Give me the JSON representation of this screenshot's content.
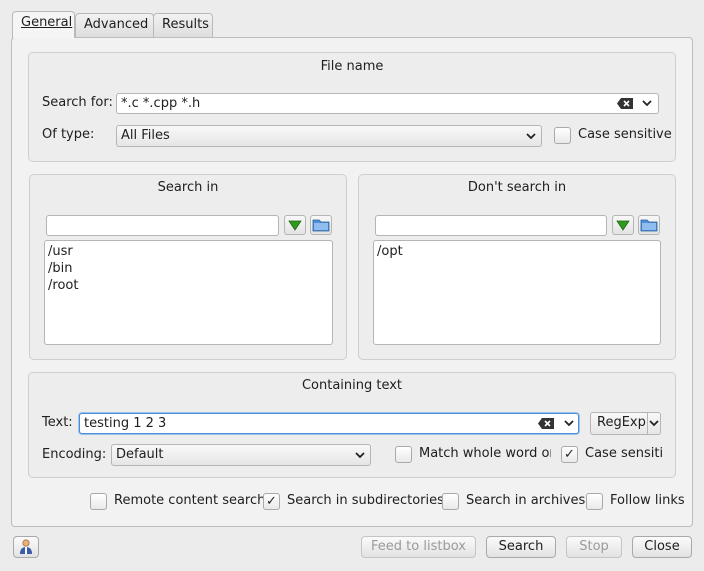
{
  "tabs": [
    {
      "label": "General"
    },
    {
      "label": "Advanced"
    },
    {
      "label": "Results"
    }
  ],
  "file_name": {
    "title": "File name",
    "search_for_label": "Search for:",
    "search_for_value": "*.c *.cpp *.h",
    "of_type_label": "Of type:",
    "of_type_value": "All Files",
    "case_sensitive_label": "Case sensitive",
    "case_sensitive_checked": false
  },
  "search_in": {
    "title": "Search in",
    "path_value": "",
    "items": [
      "/usr",
      "/bin",
      "/root"
    ]
  },
  "dont_search_in": {
    "title": "Don't search in",
    "path_value": "",
    "items": [
      "/opt"
    ]
  },
  "containing_text": {
    "title": "Containing text",
    "text_label": "Text:",
    "text_value": "testing 1 2 3",
    "regexp_label": "RegExp",
    "encoding_label": "Encoding:",
    "encoding_value": "Default",
    "match_whole_word_label": "Match whole word onl",
    "match_whole_word_checked": false,
    "case_sensitive_label": "Case sensitiv",
    "case_sensitive_checked": true
  },
  "options": {
    "remote_content_label": "Remote content search",
    "remote_content_checked": false,
    "subdirectories_label": "Search in subdirectories",
    "subdirectories_checked": true,
    "archives_label": "Search in archives",
    "archives_checked": false,
    "follow_links_label": "Follow links",
    "follow_links_checked": false
  },
  "buttons": {
    "feed_label": "Feed to listbox",
    "search_label": "Search",
    "stop_label": "Stop",
    "close_label": "Close"
  },
  "colors": {
    "focus_border": "#4a8fd8",
    "green_arrow": "#2e9a1e",
    "folder_blue": "#4d8ed6"
  }
}
